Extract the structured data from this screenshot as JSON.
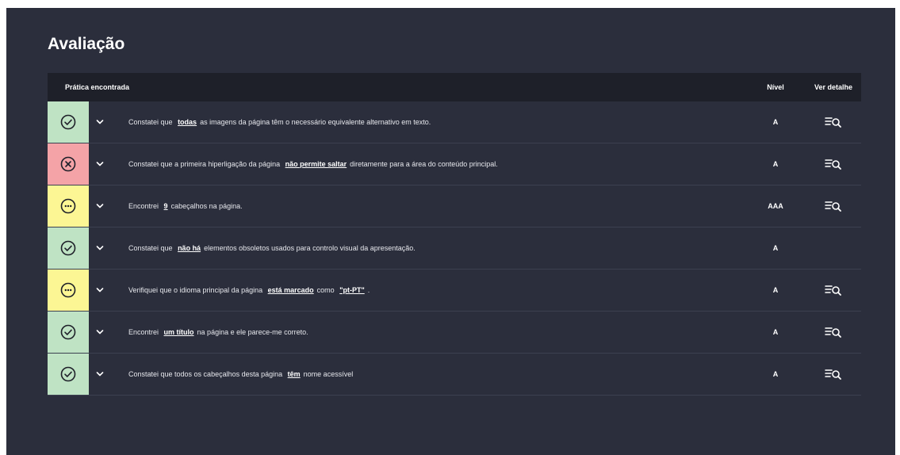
{
  "title": "Avaliação",
  "columns": {
    "practice": "Prática encontrada",
    "level": "Nível",
    "detail": "Ver detalhe"
  },
  "colors": {
    "ok": "#bfe3c4",
    "error": "#f4a3a7",
    "warning": "#fcf694",
    "panel": "#2b2e3c",
    "header": "#1e2029"
  },
  "rows": [
    {
      "status": "ok",
      "status_icon": "check-circle-icon",
      "pre": "Constatei que",
      "highlight": "todas",
      "post": "as imagens da página têm o necessário equivalente alternativo em texto.",
      "level": "A",
      "has_detail": true
    },
    {
      "status": "error",
      "status_icon": "x-circle-icon",
      "pre": "Constatei que a primeira hiperligação da página",
      "highlight": "não permite saltar",
      "post": "diretamente para a área do conteúdo principal.",
      "level": "A",
      "has_detail": true
    },
    {
      "status": "warning",
      "status_icon": "ellipsis-circle-icon",
      "pre": "Encontrei",
      "highlight": "9",
      "post": "cabeçalhos na página.",
      "level": "AAA",
      "has_detail": true
    },
    {
      "status": "ok",
      "status_icon": "check-circle-icon",
      "pre": "Constatei que",
      "highlight": "não há",
      "post": "elementos obsoletos usados para controlo visual da apresentação.",
      "level": "A",
      "has_detail": false
    },
    {
      "status": "warning",
      "status_icon": "ellipsis-circle-icon",
      "pre": "Verifiquei que o idioma principal da página",
      "highlight": "está marcado",
      "post": "como",
      "highlight2": "\"pt-PT\"",
      "post2": ".",
      "level": "A",
      "has_detail": true
    },
    {
      "status": "ok",
      "status_icon": "check-circle-icon",
      "pre": "Encontrei",
      "highlight": "um título",
      "post": "na página e ele parece-me correto.",
      "level": "A",
      "has_detail": true
    },
    {
      "status": "ok",
      "status_icon": "check-circle-icon",
      "pre": "Constatei que todos os cabeçalhos desta página",
      "highlight": "têm",
      "post": "nome acessível",
      "level": "A",
      "has_detail": true
    }
  ]
}
